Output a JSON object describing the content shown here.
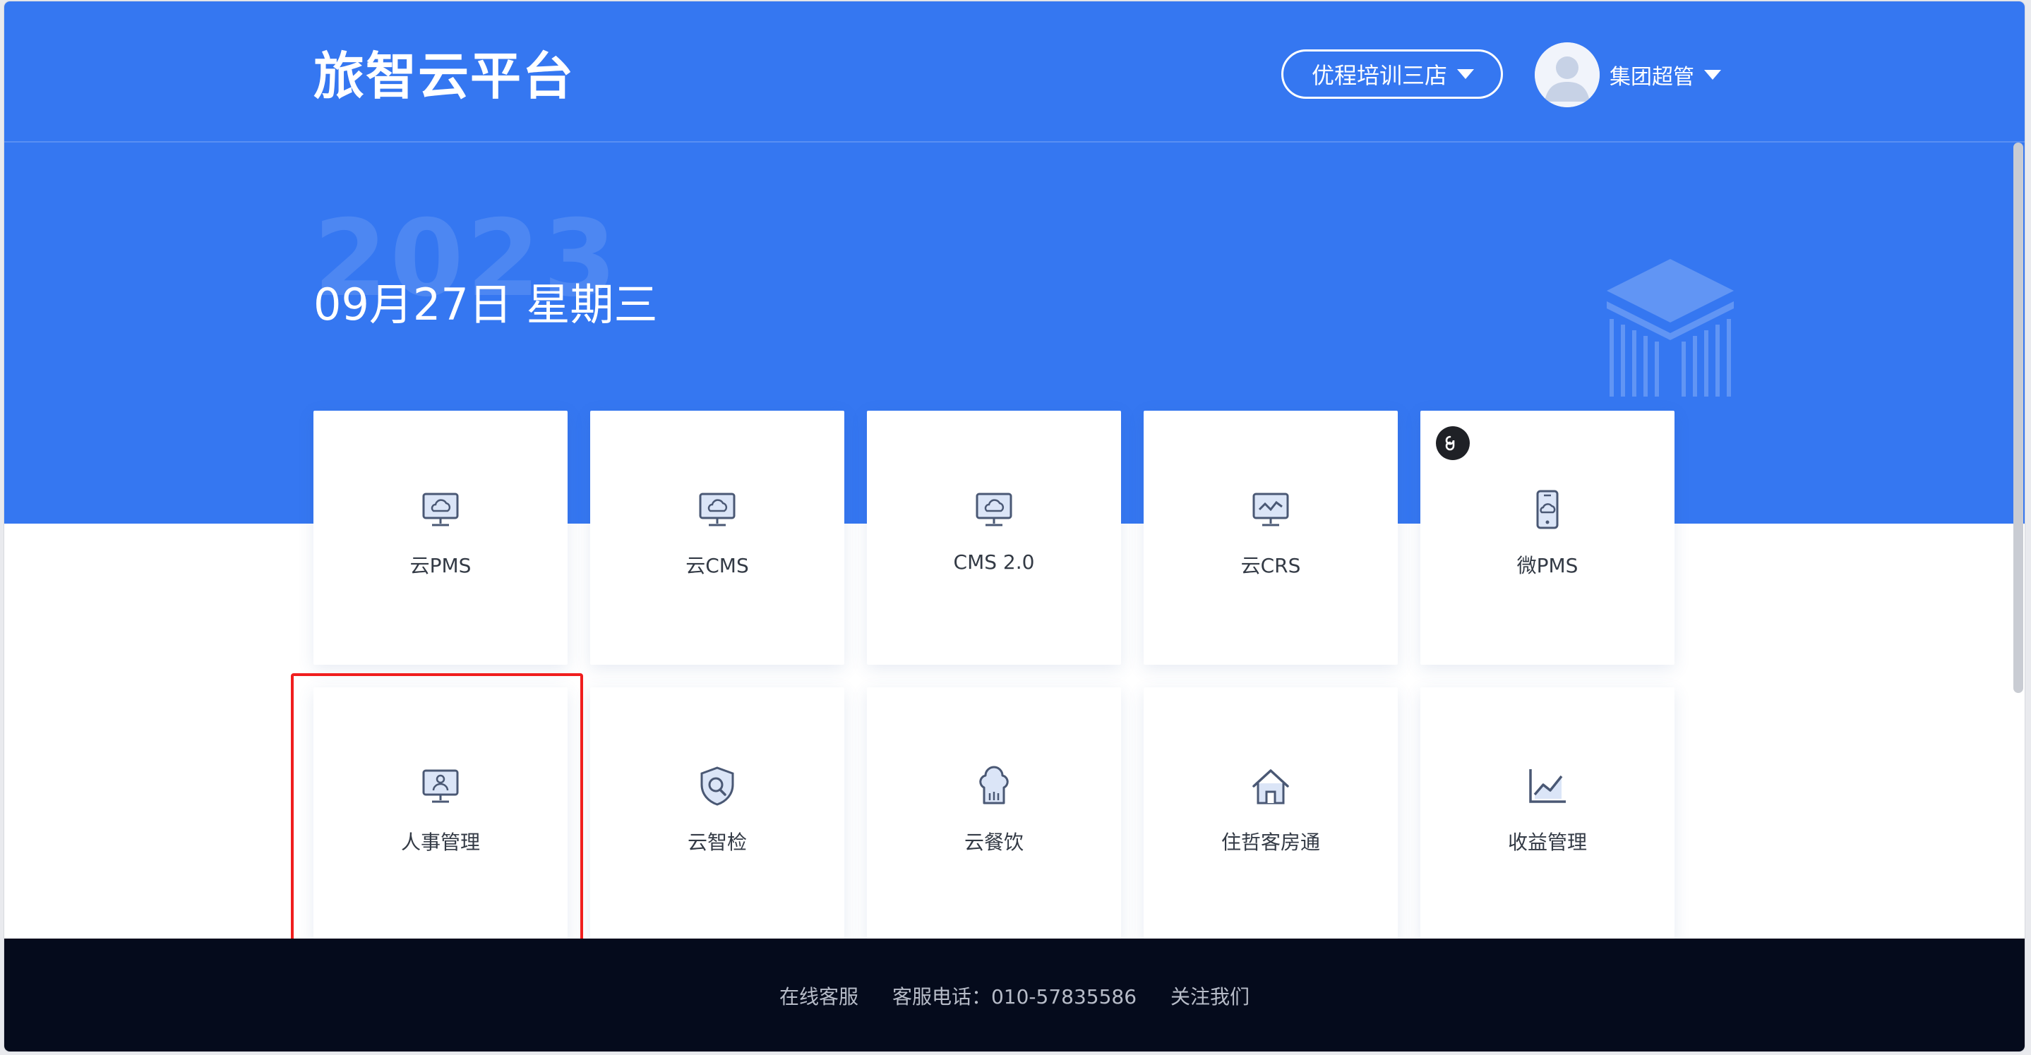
{
  "header": {
    "logo": "旅智云平台",
    "store_selector": "优程培训三店",
    "user_name": "集团超管"
  },
  "banner": {
    "year": "2023",
    "date": "09月27日 星期三"
  },
  "apps": [
    {
      "label": "云PMS",
      "icon": "monitor-cloud-icon"
    },
    {
      "label": "云CMS",
      "icon": "monitor-cloud-icon"
    },
    {
      "label": "CMS 2.0",
      "icon": "monitor-cloud-icon"
    },
    {
      "label": "云CRS",
      "icon": "monitor-chart-icon"
    },
    {
      "label": "微PMS",
      "icon": "phone-cloud-icon",
      "badge": "mini-program-icon"
    },
    {
      "label": "人事管理",
      "icon": "monitor-user-icon"
    },
    {
      "label": "云智检",
      "icon": "shield-search-icon"
    },
    {
      "label": "云餐饮",
      "icon": "chef-hat-icon"
    },
    {
      "label": "住哲客房通",
      "icon": "house-icon"
    },
    {
      "label": "收益管理",
      "icon": "line-chart-icon"
    }
  ],
  "footer": {
    "service": "在线客服",
    "phone": "客服电话：010-57835586",
    "follow": "关注我们"
  },
  "colors": {
    "brand": "#3577f1",
    "footer_bg": "#050b1c",
    "highlight": "#f01e1e",
    "icon_stroke": "#4a5874"
  }
}
